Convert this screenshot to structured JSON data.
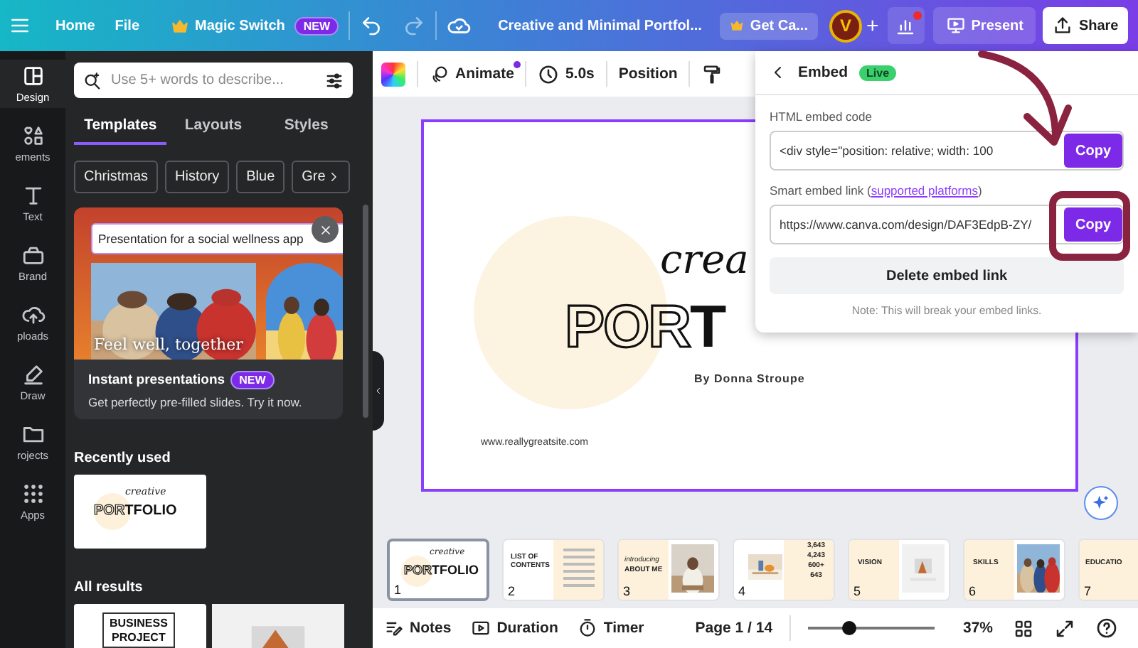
{
  "top_bar": {
    "menu_items": [
      "Home",
      "File"
    ],
    "magic_switch": {
      "label": "Magic Switch",
      "badge": "NEW"
    },
    "document_title": "Creative and Minimal Portfol...",
    "upgrade_button": "Get Ca...",
    "avatar_initial": "V",
    "add_label": "+",
    "analytics_notification": true,
    "present_button": "Present",
    "share_button": "Share"
  },
  "sidebar": {
    "items": [
      {
        "label": "Design",
        "kind": "design",
        "selected": true
      },
      {
        "label": "ements",
        "kind": "elements",
        "selected": false
      },
      {
        "label": "Text",
        "kind": "text",
        "selected": false
      },
      {
        "label": "Brand",
        "kind": "brand",
        "selected": false
      },
      {
        "label": "ploads",
        "kind": "uploads",
        "selected": false
      },
      {
        "label": "Draw",
        "kind": "draw",
        "selected": false
      },
      {
        "label": "rojects",
        "kind": "projects",
        "selected": false
      },
      {
        "label": "Apps",
        "kind": "apps",
        "selected": false
      }
    ]
  },
  "panel": {
    "search": {
      "placeholder": "Use 5+ words to describe..."
    },
    "tabs": [
      {
        "label": "Templates",
        "selected": true
      },
      {
        "label": "Layouts",
        "selected": false
      },
      {
        "label": "Styles",
        "selected": false
      }
    ],
    "chips": [
      "Christmas",
      "History",
      "Blue",
      "Gre"
    ],
    "promo": {
      "prompt": "Presentation for a social wellness app",
      "image_caption": "Feel well, together",
      "title": "Instant presentations",
      "badge": "NEW",
      "description": "Get perfectly pre-filled slides. Try it now."
    },
    "recently_used": {
      "heading": "Recently used",
      "items": [
        {
          "script": "creative",
          "title_outline": "POR",
          "title_solid": "TFOLIO"
        }
      ]
    },
    "all_results": {
      "heading": "All results",
      "items": [
        {
          "kind": "text",
          "lines": [
            "BUSINESS",
            "PROJECT"
          ]
        },
        {
          "kind": "picture"
        }
      ]
    }
  },
  "editor_toolbar": {
    "animate": "Animate",
    "animate_dot": true,
    "duration": "5.0s",
    "position": "Position"
  },
  "slide": {
    "script": "crea",
    "title_outline": "POR",
    "title_solid": "T",
    "author": "By Donna Stroupe",
    "website": "www.reallygreatsite.com"
  },
  "embed_popup": {
    "title": "Embed",
    "status": "Live",
    "html_label": "HTML embed code",
    "html_code": "<div style=\"position: relative; width: 100",
    "html_copy": "Copy",
    "smart_label": "Smart embed link (",
    "smart_link": "supported platforms",
    "smart_label_end": ")",
    "smart_url": "https://www.canva.com/design/DAF3EdpB-ZY/",
    "smart_copy": "Copy",
    "delete_button": "Delete embed link",
    "note": "Note: This will break your embed links."
  },
  "filmstrip": {
    "pages": [
      {
        "number": "1",
        "selected": true,
        "kind": "cover",
        "texts": [
          "creative",
          "POR",
          "TFOLIO"
        ]
      },
      {
        "number": "2",
        "selected": false,
        "kind": "list",
        "texts": [
          "LIST OF",
          "CONTENTS"
        ]
      },
      {
        "number": "3",
        "selected": false,
        "texts": [
          "introducing",
          "ABOUT ME"
        ]
      },
      {
        "number": "4",
        "selected": false,
        "kind": "stats",
        "texts": [
          "3,643",
          "4,243",
          "600+",
          "643"
        ]
      },
      {
        "number": "5",
        "selected": false,
        "texts": [
          "VISION"
        ]
      },
      {
        "number": "6",
        "selected": false,
        "texts": [
          "SKILLS"
        ]
      },
      {
        "number": "7",
        "selected": false,
        "kind": "edge",
        "texts": [
          "EDUCATIO"
        ]
      }
    ]
  },
  "bottom_bar": {
    "notes": "Notes",
    "duration": "Duration",
    "timer": "Timer",
    "page": "Page 1 / 14",
    "zoom_slider": {
      "level": 0.33
    },
    "zoom": "37%"
  }
}
